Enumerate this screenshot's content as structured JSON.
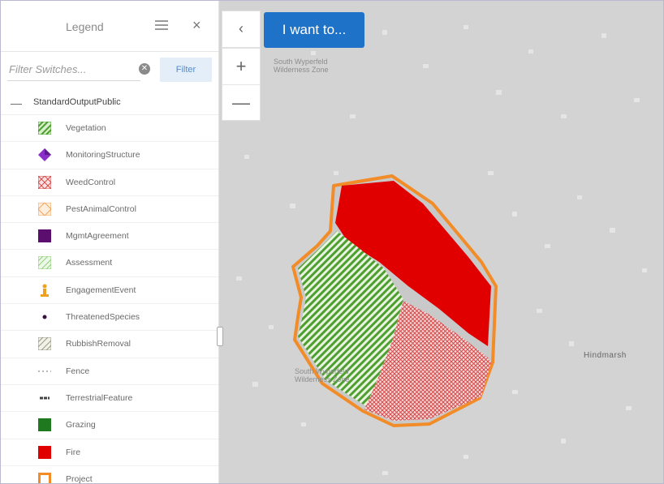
{
  "legend": {
    "title": "Legend",
    "filter": {
      "placeholder": "Filter Switches...",
      "button_label": "Filter"
    },
    "group": {
      "label": "StandardOutputPublic"
    },
    "items": [
      {
        "label": "Vegetation",
        "icon": "green-hatch-swatch"
      },
      {
        "label": "MonitoringStructure",
        "icon": "purple-diamond-swatch"
      },
      {
        "label": "WeedControl",
        "icon": "red-crosshatch-swatch"
      },
      {
        "label": "PestAnimalControl",
        "icon": "orange-crosshatch-swatch"
      },
      {
        "label": "MgmtAgreement",
        "icon": "purple-fill-swatch"
      },
      {
        "label": "Assessment",
        "icon": "lightgreen-hatch-swatch"
      },
      {
        "label": "EngagementEvent",
        "icon": "person-icon"
      },
      {
        "label": "ThreatenedSpecies",
        "icon": "dot-icon"
      },
      {
        "label": "RubbishRemoval",
        "icon": "grey-hatch-swatch"
      },
      {
        "label": "Fence",
        "icon": "dashed-line-swatch"
      },
      {
        "label": "TerrestrialFeature",
        "icon": "line-swatch"
      },
      {
        "label": "Grazing",
        "icon": "darkgreen-fill-swatch"
      },
      {
        "label": "Fire",
        "icon": "red-fill-swatch"
      },
      {
        "label": "Project",
        "icon": "orange-outline-swatch"
      }
    ]
  },
  "map": {
    "want_button": "I want to...",
    "collapse_symbol": "‹",
    "zoom_in": "+",
    "zoom_out": "—",
    "labels": {
      "north": [
        "South Wyperfeld",
        "Wilderness Zone"
      ],
      "south": [
        "South Wyperfeld",
        "Wilderness Zone"
      ],
      "town": "Hindmarsh"
    }
  },
  "colors": {
    "fire": "#e00000",
    "project": "#f28c28",
    "vegetation": "#5aa83a",
    "weed": "#e05555",
    "map_bg": "#d3d3d3",
    "button": "#1e73c8"
  }
}
